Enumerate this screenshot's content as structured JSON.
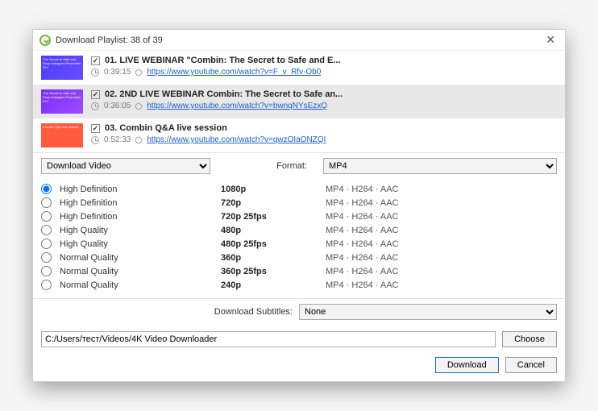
{
  "titlebar": {
    "title": "Download Playlist: 38 of 39"
  },
  "playlist": [
    {
      "thumb_class": "blue",
      "thumb_text": "The Secret to Safe and Easy Instagram Promotion Pt.1",
      "checked": true,
      "title": "01. LIVE WEBINAR \"Combin: The Secret to Safe and E...",
      "duration": "0:39:15",
      "url": "https://www.youtube.com/watch?v=F_v_Rfv-Ob0",
      "selected": false
    },
    {
      "thumb_class": "purple",
      "thumb_text": "The Secret to Safe and Easy Instagram Promotion Pt.2",
      "checked": true,
      "title": "02. 2ND LIVE WEBINAR Combin: The Secret to Safe an...",
      "duration": "0:36:05",
      "url": "https://www.youtube.com/watch?v=bwnqNYsEzxQ",
      "selected": true
    },
    {
      "thumb_class": "orange",
      "thumb_text": "Combin Q&A live session",
      "checked": true,
      "title": "03. Combin Q&A live session",
      "duration": "0:52:33",
      "url": "https://www.youtube.com/watch?v=qwzOIaONZQI",
      "selected": false
    }
  ],
  "controls": {
    "action": "Download Video",
    "format_label": "Format:",
    "format": "MP4"
  },
  "qualities": [
    {
      "label": "High Definition",
      "res": "1080p",
      "codec": "MP4 · H264 · AAC",
      "checked": true
    },
    {
      "label": "High Definition",
      "res": "720p",
      "codec": "MP4 · H264 · AAC",
      "checked": false
    },
    {
      "label": "High Definition",
      "res": "720p 25fps",
      "codec": "MP4 · H264 · AAC",
      "checked": false
    },
    {
      "label": "High Quality",
      "res": "480p",
      "codec": "MP4 · H264 · AAC",
      "checked": false
    },
    {
      "label": "High Quality",
      "res": "480p 25fps",
      "codec": "MP4 · H264 · AAC",
      "checked": false
    },
    {
      "label": "Normal Quality",
      "res": "360p",
      "codec": "MP4 · H264 · AAC",
      "checked": false
    },
    {
      "label": "Normal Quality",
      "res": "360p 25fps",
      "codec": "MP4 · H264 · AAC",
      "checked": false
    },
    {
      "label": "Normal Quality",
      "res": "240p",
      "codec": "MP4 · H264 · AAC",
      "checked": false
    }
  ],
  "subtitles": {
    "label": "Download Subtitles:",
    "value": "None"
  },
  "path": {
    "value": "C:/Users/тест/Videos/4K Video Downloader",
    "choose": "Choose"
  },
  "footer": {
    "download": "Download",
    "cancel": "Cancel"
  }
}
